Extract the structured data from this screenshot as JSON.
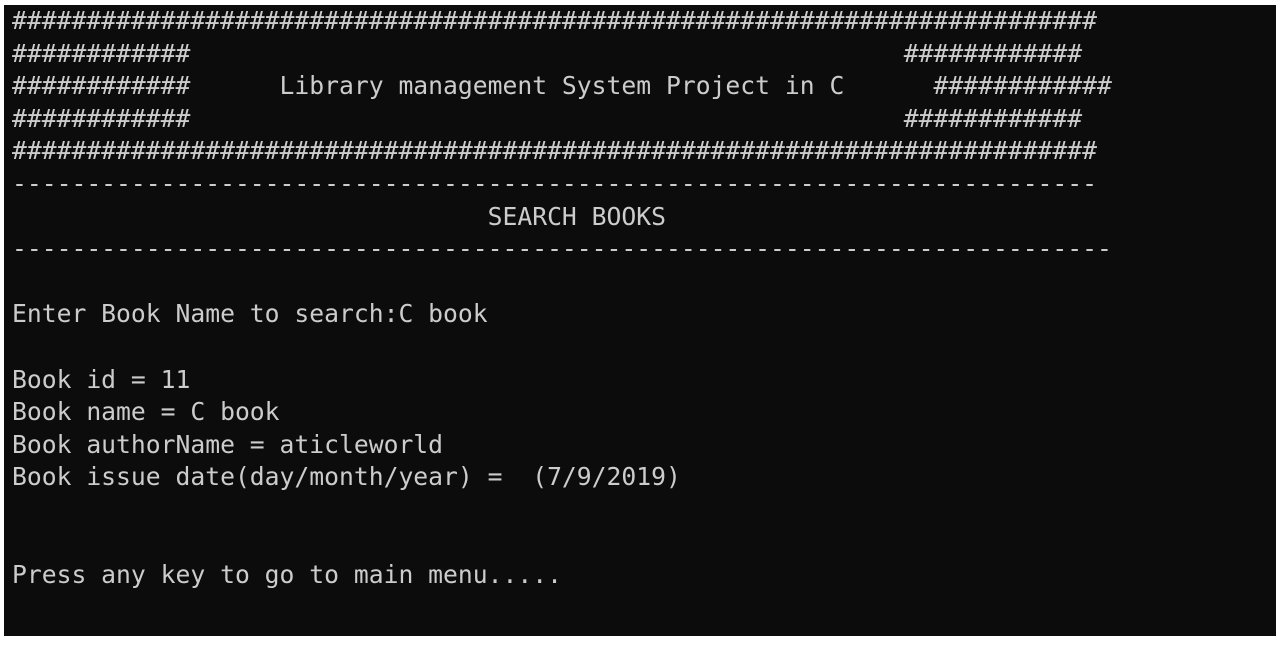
{
  "banner": {
    "border_top": "#########################################################################",
    "side_line_1": "############                                                ############",
    "title_line": "############      Library management System Project in C      ############",
    "side_line_2": "############                                                ############",
    "border_bottom": "#########################################################################"
  },
  "section": {
    "divider_top": "-------------------------------------------------------------------------",
    "heading": "                                SEARCH BOOKS",
    "divider_bottom": "--------------------------------------------------------------------------"
  },
  "search": {
    "prompt_line": "Enter Book Name to search:C book"
  },
  "result": {
    "id_line": "Book id = 11",
    "name_line": "Book name = C book",
    "author_line": "Book authorName = aticleworld",
    "issue_date_line": "Book issue date(day/month/year) =  (7/9/2019)"
  },
  "footer": {
    "continue_prompt": "Press any key to go to main menu....."
  },
  "colors": {
    "console_background": "#0c0c0c",
    "console_text": "#cccccc",
    "page_background": "#ffffff"
  }
}
